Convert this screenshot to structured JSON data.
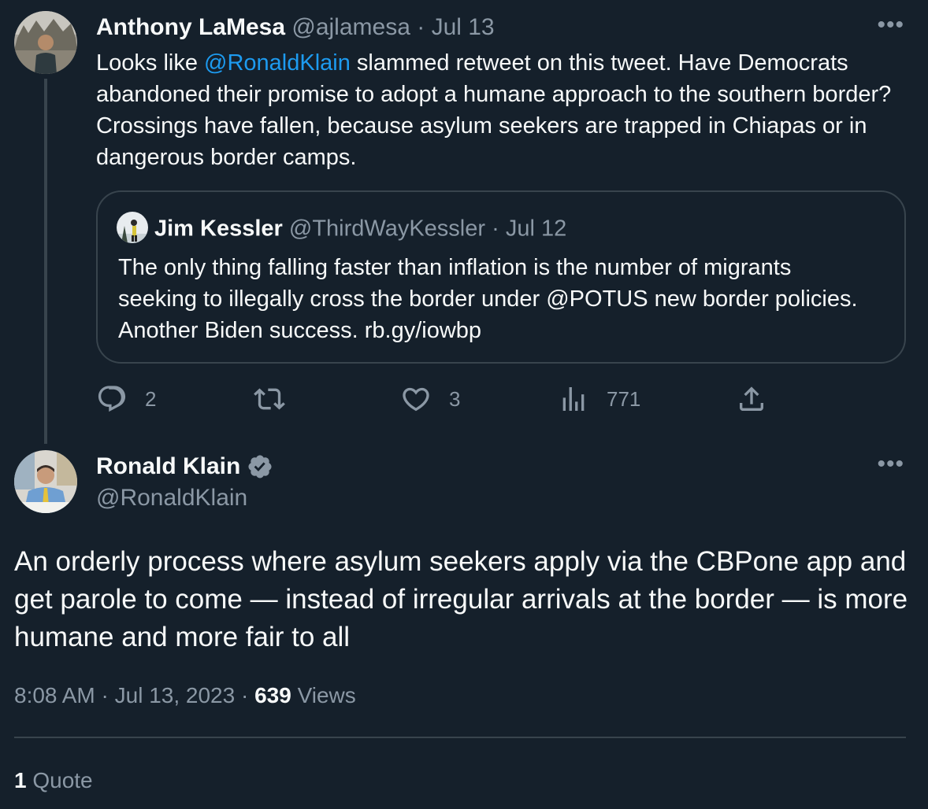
{
  "reply_tweet": {
    "author_name": "Anthony LaMesa",
    "handle": "@ajlamesa",
    "separator": " · ",
    "date": "Jul 13",
    "text_prefix": "Looks like ",
    "mention": "@RonaldKlain",
    "text_suffix": " slammed retweet on this tweet. Have Democrats abandoned their promise to adopt a humane approach to the southern border? Crossings have fallen, because asylum seekers are trapped in Chiapas or in dangerous border camps.",
    "quoted_tweet": {
      "author_name": "Jim Kessler",
      "handle": "@ThirdWayKessler",
      "separator": " · ",
      "date": "Jul 12",
      "text": "The only thing falling faster than inflation is the number of migrants seeking to illegally cross the border under @POTUS new border policies. Another Biden success. rb.gy/iowbp"
    },
    "actions": {
      "replies": "2",
      "retweets": "",
      "likes": "3",
      "views": "771"
    },
    "more_icon": "more-horizontal-icon"
  },
  "main_tweet": {
    "author_name": "Ronald Klain",
    "verified_icon": "verified-badge-icon",
    "handle": "@RonaldKlain",
    "text": "An orderly process where asylum seekers apply via the CBPone app and get parole to come — instead of irregular arrivals at the border — is more humane and more fair to all",
    "time": "8:08 AM",
    "meta_sep": " · ",
    "date": "Jul 13, 2023",
    "views_count": "639",
    "views_label": " Views",
    "quote_count": "1",
    "quote_label": " Quote",
    "more_icon": "more-horizontal-icon"
  },
  "colors": {
    "background": "#15202b",
    "text": "#f7f9f9",
    "muted": "#8b98a5",
    "link": "#1d9bf0",
    "border": "#38444d",
    "verified": "#8b98a5"
  }
}
